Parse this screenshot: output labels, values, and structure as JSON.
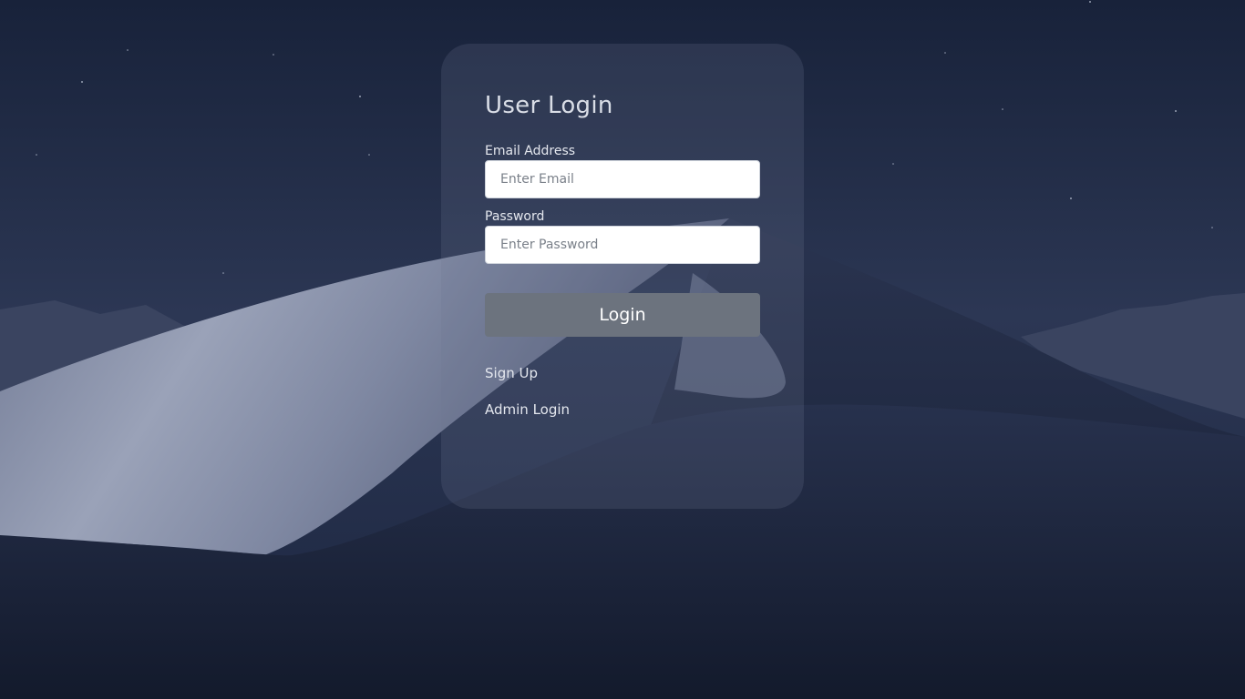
{
  "login": {
    "title": "User Login",
    "email_label": "Email Address",
    "email_placeholder": "Enter Email",
    "email_value": "",
    "password_label": "Password",
    "password_placeholder": "Enter Password",
    "password_value": "",
    "submit_label": "Login",
    "signup_link": "Sign Up",
    "admin_link": "Admin Login"
  },
  "colors": {
    "sky_top": "#1b2640",
    "dune_light": "#8a93ab",
    "dune_dark": "#1f2942",
    "card_overlay": "rgba(110,120,145,0.22)",
    "button_bg": "#6c737e",
    "text_light": "#e4e7ee"
  }
}
